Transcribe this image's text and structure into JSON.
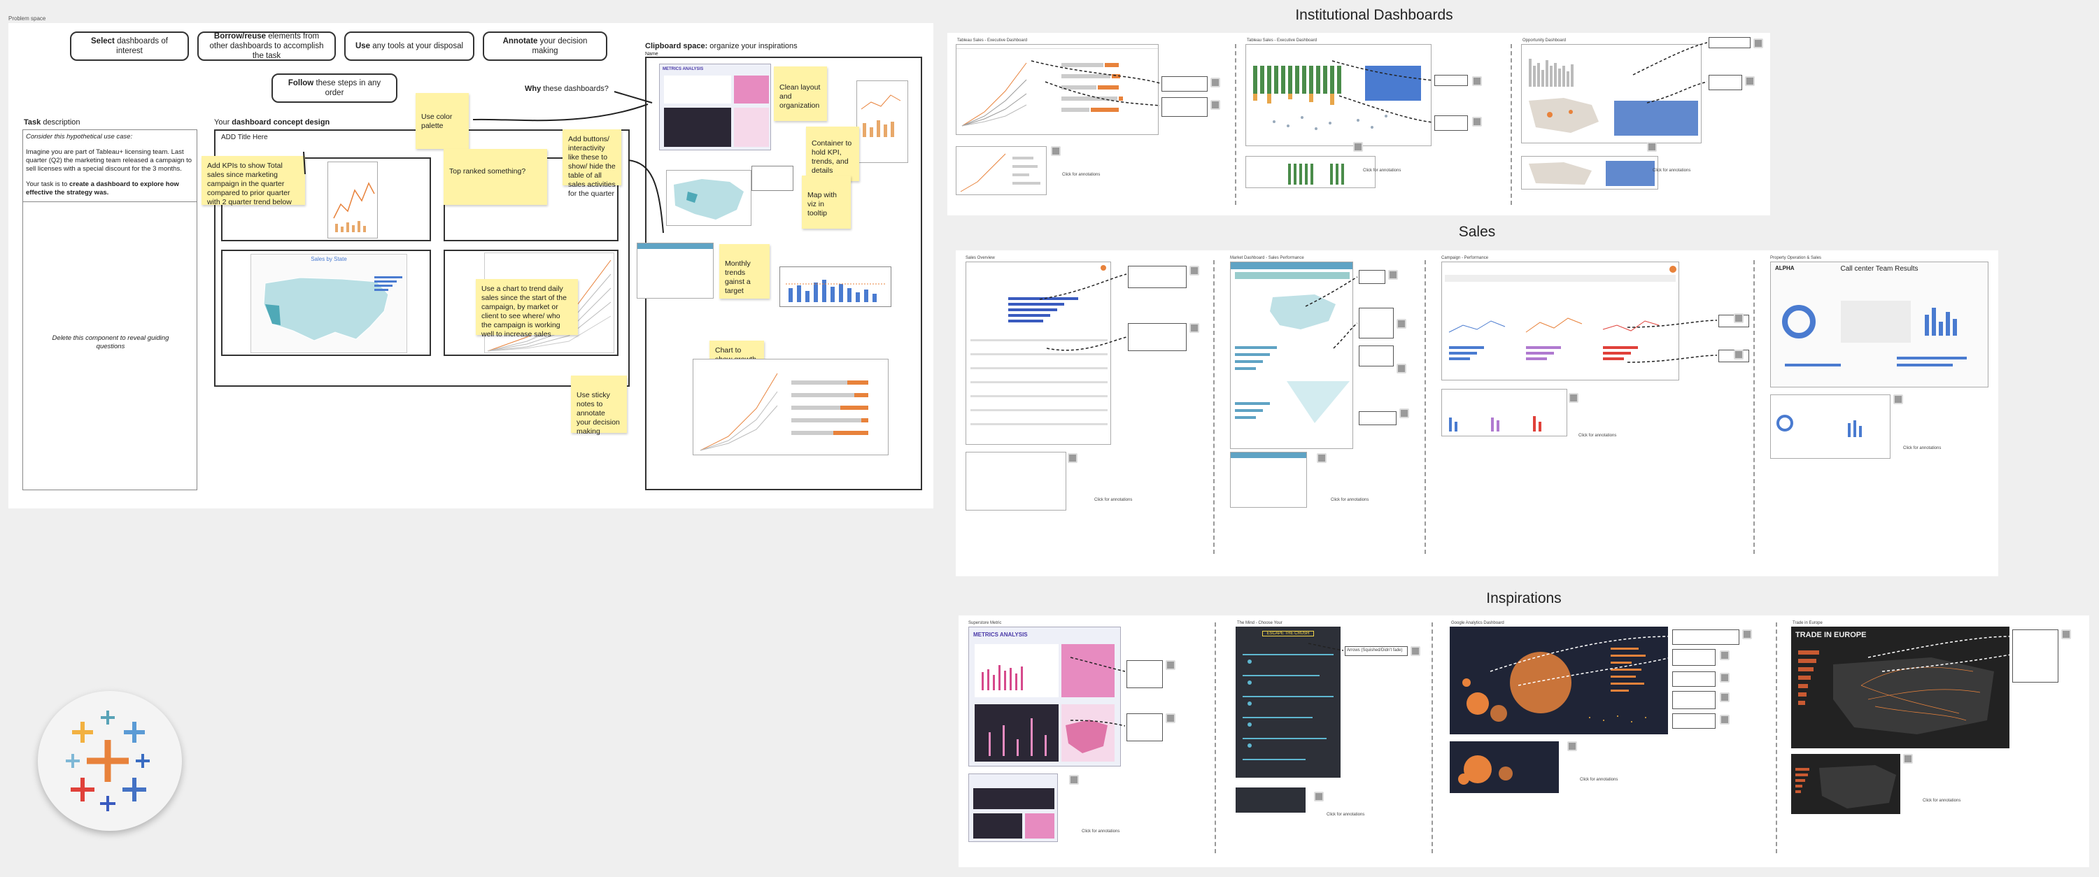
{
  "frame_label": "Problem space",
  "steps": [
    {
      "bold": "Select",
      "rest": " dashboards of interest"
    },
    {
      "bold": "Borrow/reuse",
      "rest": " elements from other dashboards to accomplish the task"
    },
    {
      "bold": "Use",
      "rest": " any tools at your disposal"
    },
    {
      "bold": "Annotate",
      "rest": " your decision making"
    },
    {
      "bold": "Follow",
      "rest": " these steps in any order"
    }
  ],
  "task": {
    "title_bold": "Task",
    "title_rest": " description",
    "p1": "Consider this hypothetical use case:",
    "p2": "Imagine you are part of Tableau+ licensing team. Last quarter (Q2) the marketing team released a campaign to sell licenses with a special discount for the 3 months.",
    "p3_pre": "Your task is to ",
    "p3_bold": "create a dashboard to explore how effective the strategy was.",
    "delete_note": "Delete this component to reveal guiding questions"
  },
  "concept": {
    "title_pre": "Your ",
    "title_bold": "dashboard concept design",
    "add_title": "ADD Title Here",
    "map_title": "Sales by State"
  },
  "stickies": {
    "color_palette": "Use color palette",
    "kpis": "Add KPIs to show Total sales since marketing campaign in the quarter compared to prior quarter with 2 quarter trend below",
    "top_ranked": "Top ranked something?",
    "buttons": "Add buttons/ interactivity like these to show/ hide the table of all sales activities for the quarter",
    "trend_chart": "Use a chart to trend daily sales since the start of the campaign, by market or client to see where/ who the campaign is working well to increase sales",
    "annotate": "Use sticky notes to annotate your decision making",
    "clean_layout": "Clean layout and organization",
    "container": "Container to hold KPI, trends, and details",
    "map_viz": "Map with viz in tooltip",
    "monthly": "Monthly trends gainst a target",
    "chart_growth": "Chart to show growth since the start of the campaign, with highlighted lines"
  },
  "why_label_bold": "Why",
  "why_label_rest": " these dashboards?",
  "clipboard": {
    "title_bold": "Clipboard space:",
    "title_rest": " organize your inspirations",
    "sub": "Name"
  },
  "sections": {
    "institutional": "Institutional Dashboards",
    "sales": "Sales",
    "inspirations": "Inspirations"
  },
  "thumb_titles": {
    "inst1": "Tableau Sales - Executive Dashboard",
    "inst2": "Tableau Sales - Executive Dashboard",
    "inst3": "Opportunity Dashboard",
    "sales1": "Sales Overview",
    "sales2": "Market Dashboard - Sales Performance",
    "sales3": "Campaign - Performance",
    "sales4": "Property Operation & Sales",
    "insp1": "Superstore Metric",
    "insp2": "The Mind - Choose Your",
    "insp3": "Google Analytics Dashboard",
    "insp4": "Trade in Europe"
  },
  "callcenter_title": "Call center Team Results",
  "alpha_label": "ALPHA",
  "trade_title": "TRADE IN EUROPE",
  "metrics_title": "METRICS ANALYSIS",
  "escape_title": "ESCAPE THE CRUSH",
  "annotation_tag": "Arrows (Squished/Didn't fade)",
  "click_annotations": "Click for annotations",
  "colors": {
    "sticky": "#fff3a6",
    "accent_blue": "#4a7bd0",
    "accent_orange": "#e8823b",
    "dark_panel": "#2b2735"
  }
}
